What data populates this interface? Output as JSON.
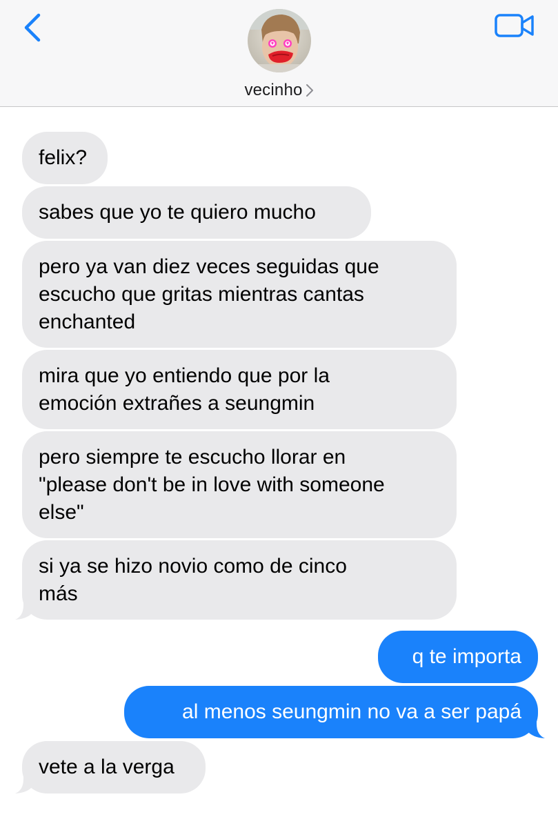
{
  "header": {
    "contact_name": "vecinho",
    "back_icon": "chevron-left-icon",
    "video_icon": "video-camera-icon",
    "accent_color": "#1a82fb"
  },
  "messages": [
    {
      "direction": "incoming",
      "lines": [
        "felix?"
      ]
    },
    {
      "direction": "incoming",
      "lines": [
        "sabes que yo te quiero mucho"
      ]
    },
    {
      "direction": "incoming",
      "lines": [
        "pero ya van diez veces seguidas que",
        "escucho que gritas mientras cantas",
        "enchanted"
      ]
    },
    {
      "direction": "incoming",
      "lines": [
        "mira que yo entiendo que por la",
        "emoción extrañes a seungmin"
      ]
    },
    {
      "direction": "incoming",
      "lines": [
        "pero siempre te escucho llorar en",
        "\"please don't be in love with someone",
        "else\""
      ]
    },
    {
      "direction": "incoming",
      "lines": [
        "si ya se hizo novio como de cinco",
        "más"
      ]
    },
    {
      "direction": "outgoing",
      "lines": [
        "q te importa"
      ]
    },
    {
      "direction": "outgoing",
      "lines": [
        "al menos seungmin no va a ser papá"
      ]
    },
    {
      "direction": "incoming",
      "lines": [
        "vete a la verga"
      ]
    }
  ]
}
